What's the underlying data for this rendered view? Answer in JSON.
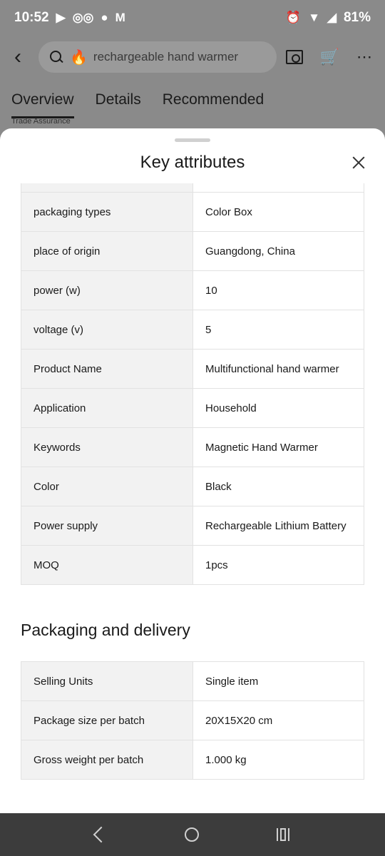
{
  "status_bar": {
    "time": "10:52",
    "battery": "81%"
  },
  "app_bar": {
    "search_text": "rechargeable hand warmer"
  },
  "tabs": [
    {
      "label": "Overview"
    },
    {
      "label": "Details"
    },
    {
      "label": "Recommended"
    }
  ],
  "peek_text": "Trade Assurance",
  "sheet": {
    "title": "Key attributes",
    "attributes": [
      {
        "key": "packaging types",
        "value": "Color Box"
      },
      {
        "key": "place of origin",
        "value": "Guangdong, China"
      },
      {
        "key": "power (w)",
        "value": "10"
      },
      {
        "key": "voltage (v)",
        "value": "5"
      },
      {
        "key": "Product Name",
        "value": "Multifunctional hand warmer"
      },
      {
        "key": "Application",
        "value": "Household"
      },
      {
        "key": "Keywords",
        "value": "Magnetic Hand Warmer"
      },
      {
        "key": "Color",
        "value": "Black"
      },
      {
        "key": "Power supply",
        "value": "Rechargeable Lithium Battery"
      },
      {
        "key": "MOQ",
        "value": "1pcs"
      }
    ],
    "packaging_title": "Packaging and delivery",
    "packaging": [
      {
        "key": "Selling Units",
        "value": "Single item"
      },
      {
        "key": "Package size per batch",
        "value": "20X15X20 cm"
      },
      {
        "key": "Gross weight per batch",
        "value": "1.000 kg"
      }
    ]
  },
  "icons": {
    "back": "back-arrow-icon",
    "search": "search-icon",
    "camera": "camera-icon",
    "cart": "cart-icon",
    "more": "more-icon",
    "close": "close-icon"
  }
}
